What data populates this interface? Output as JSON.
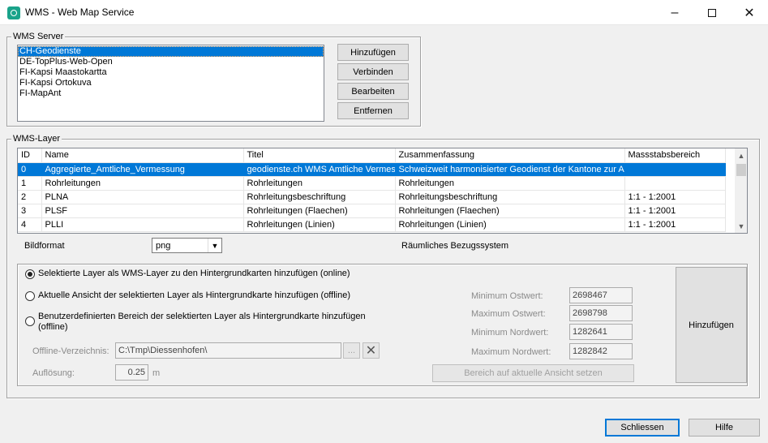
{
  "window": {
    "title": "WMS - Web Map Service",
    "minimize_icon": "minimize-icon",
    "maximize_icon": "maximize-icon",
    "close_icon": "close-icon"
  },
  "server_group": {
    "label": "WMS Server",
    "servers": [
      "CH-Geodienste",
      "DE-TopPlus-Web-Open",
      "FI-Kapsi Maastokartta",
      "FI-Kapsi Ortokuva",
      "FI-MapAnt"
    ],
    "selected_index": 0,
    "buttons": {
      "add": "Hinzufügen",
      "connect": "Verbinden",
      "edit": "Bearbeiten",
      "remove": "Entfernen"
    }
  },
  "layer_group": {
    "label": "WMS-Layer",
    "columns": [
      "ID",
      "Name",
      "Titel",
      "Zusammenfassung",
      "Massstabsbereich"
    ],
    "rows": [
      [
        "0",
        "Aggregierte_Amtliche_Vermessung",
        "geodienste.ch WMS Amtliche Vermessung",
        "Schweizweit harmonisierter Geodienst der Kantone zur Amtlichen Vermessung",
        ""
      ],
      [
        "1",
        "Rohrleitungen",
        "Rohrleitungen",
        "Rohrleitungen",
        ""
      ],
      [
        "2",
        "PLNA",
        "Rohrleitungsbeschriftung",
        "Rohrleitungsbeschriftung",
        "1:1 - 1:2001"
      ],
      [
        "3",
        "PLSF",
        "Rohrleitungen (Flaechen)",
        "Rohrleitungen (Flaechen)",
        "1:1 - 1:2001"
      ],
      [
        "4",
        "PLLI",
        "Rohrleitungen (Linien)",
        "Rohrleitungen (Linien)",
        "1:1 - 1:2001"
      ]
    ],
    "selected_row": 0,
    "image_format_label": "Bildformat",
    "image_format_value": "png",
    "crs_label": "Räumliches Bezugssystem"
  },
  "options": {
    "radio_online": "Selektierte Layer als WMS-Layer zu den Hintergrundkarten hinzufügen (online)",
    "radio_offline_view": "Aktuelle Ansicht der selektierten Layer als Hintergrundkarte hinzufügen (offline)",
    "radio_offline_custom_line1": "Benutzerdefinierten Bereich der selektierten Layer als Hintergrundkarte hinzufügen",
    "radio_offline_custom_line2": "(offline)",
    "checked": "online",
    "offline_dir_label": "Offline-Verzeichnis:",
    "offline_dir_value": "C:\\Tmp\\Diessenhofen\\",
    "browse_label": "...",
    "resolution_label": "Auflösung:",
    "resolution_value": "0.25",
    "resolution_unit": "m",
    "min_east_label": "Minimum Ostwert:",
    "min_east_value": "2698467",
    "max_east_label": "Maximum Ostwert:",
    "max_east_value": "2698798",
    "min_north_label": "Minimum Nordwert:",
    "min_north_value": "1282641",
    "max_north_label": "Maximum Nordwert:",
    "max_north_value": "1282842",
    "set_extent_button": "Bereich auf aktuelle Ansicht setzen",
    "add_button": "Hinzufügen"
  },
  "footer": {
    "close_button": "Schliessen",
    "help_button": "Hilfe"
  }
}
